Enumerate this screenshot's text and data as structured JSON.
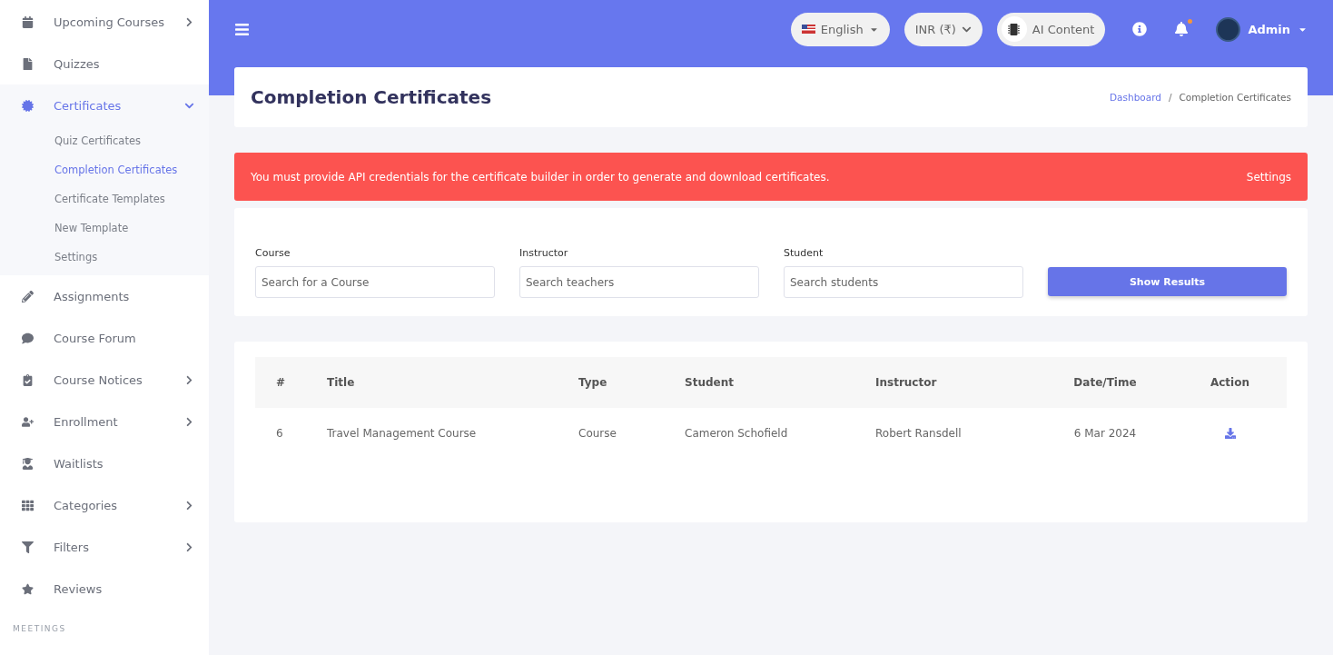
{
  "sidebar": {
    "items": [
      {
        "label": "Upcoming Courses",
        "submenu": true,
        "expanded": false,
        "selected": false
      },
      {
        "label": "Quizzes",
        "submenu": false,
        "selected": false
      },
      {
        "label": "Certificates",
        "submenu": true,
        "expanded": true,
        "selected": true,
        "children": [
          {
            "label": "Quiz Certificates",
            "selected": false
          },
          {
            "label": "Completion Certificates",
            "selected": true
          },
          {
            "label": "Certificate Templates",
            "selected": false
          },
          {
            "label": "New Template",
            "selected": false
          },
          {
            "label": "Settings",
            "selected": false
          }
        ]
      },
      {
        "label": "Assignments",
        "submenu": false,
        "selected": false
      },
      {
        "label": "Course Forum",
        "submenu": false,
        "selected": false
      },
      {
        "label": "Course Notices",
        "submenu": true,
        "expanded": false,
        "selected": false
      },
      {
        "label": "Enrollment",
        "submenu": true,
        "expanded": false,
        "selected": false
      },
      {
        "label": "Waitlists",
        "submenu": false,
        "selected": false
      },
      {
        "label": "Categories",
        "submenu": true,
        "expanded": false,
        "selected": false
      },
      {
        "label": "Filters",
        "submenu": true,
        "expanded": false,
        "selected": false
      },
      {
        "label": "Reviews",
        "submenu": false,
        "selected": false
      }
    ],
    "section_heading": "MEETINGS"
  },
  "topbar": {
    "language": "English",
    "currency": "INR (₹)",
    "ai_button": "AI Content",
    "notification_dot": true,
    "user": "Admin"
  },
  "page": {
    "title": "Completion Certificates",
    "breadcrumb_separator": "/",
    "breadcrumb": [
      {
        "label": "Dashboard",
        "link": true
      },
      {
        "label": "Completion Certificates",
        "link": false
      }
    ]
  },
  "alert": {
    "message": "You must provide API credentials for the certificate builder in order to generate and download certificates.",
    "action": "Settings"
  },
  "filters": {
    "fields": [
      {
        "label": "Course",
        "placeholder": "Search for a Course"
      },
      {
        "label": "Instructor",
        "placeholder": "Search teachers"
      },
      {
        "label": "Student",
        "placeholder": "Search students"
      }
    ],
    "button": "Show Results"
  },
  "table": {
    "columns": [
      "#",
      "Title",
      "Type",
      "Student",
      "Instructor",
      "Date/Time",
      "Action"
    ],
    "rows": [
      {
        "cells": [
          "6",
          "Travel Management Course",
          "Course",
          "Cameron Schofield",
          "Robert Ransdell",
          "6 Mar 2024"
        ]
      }
    ]
  }
}
